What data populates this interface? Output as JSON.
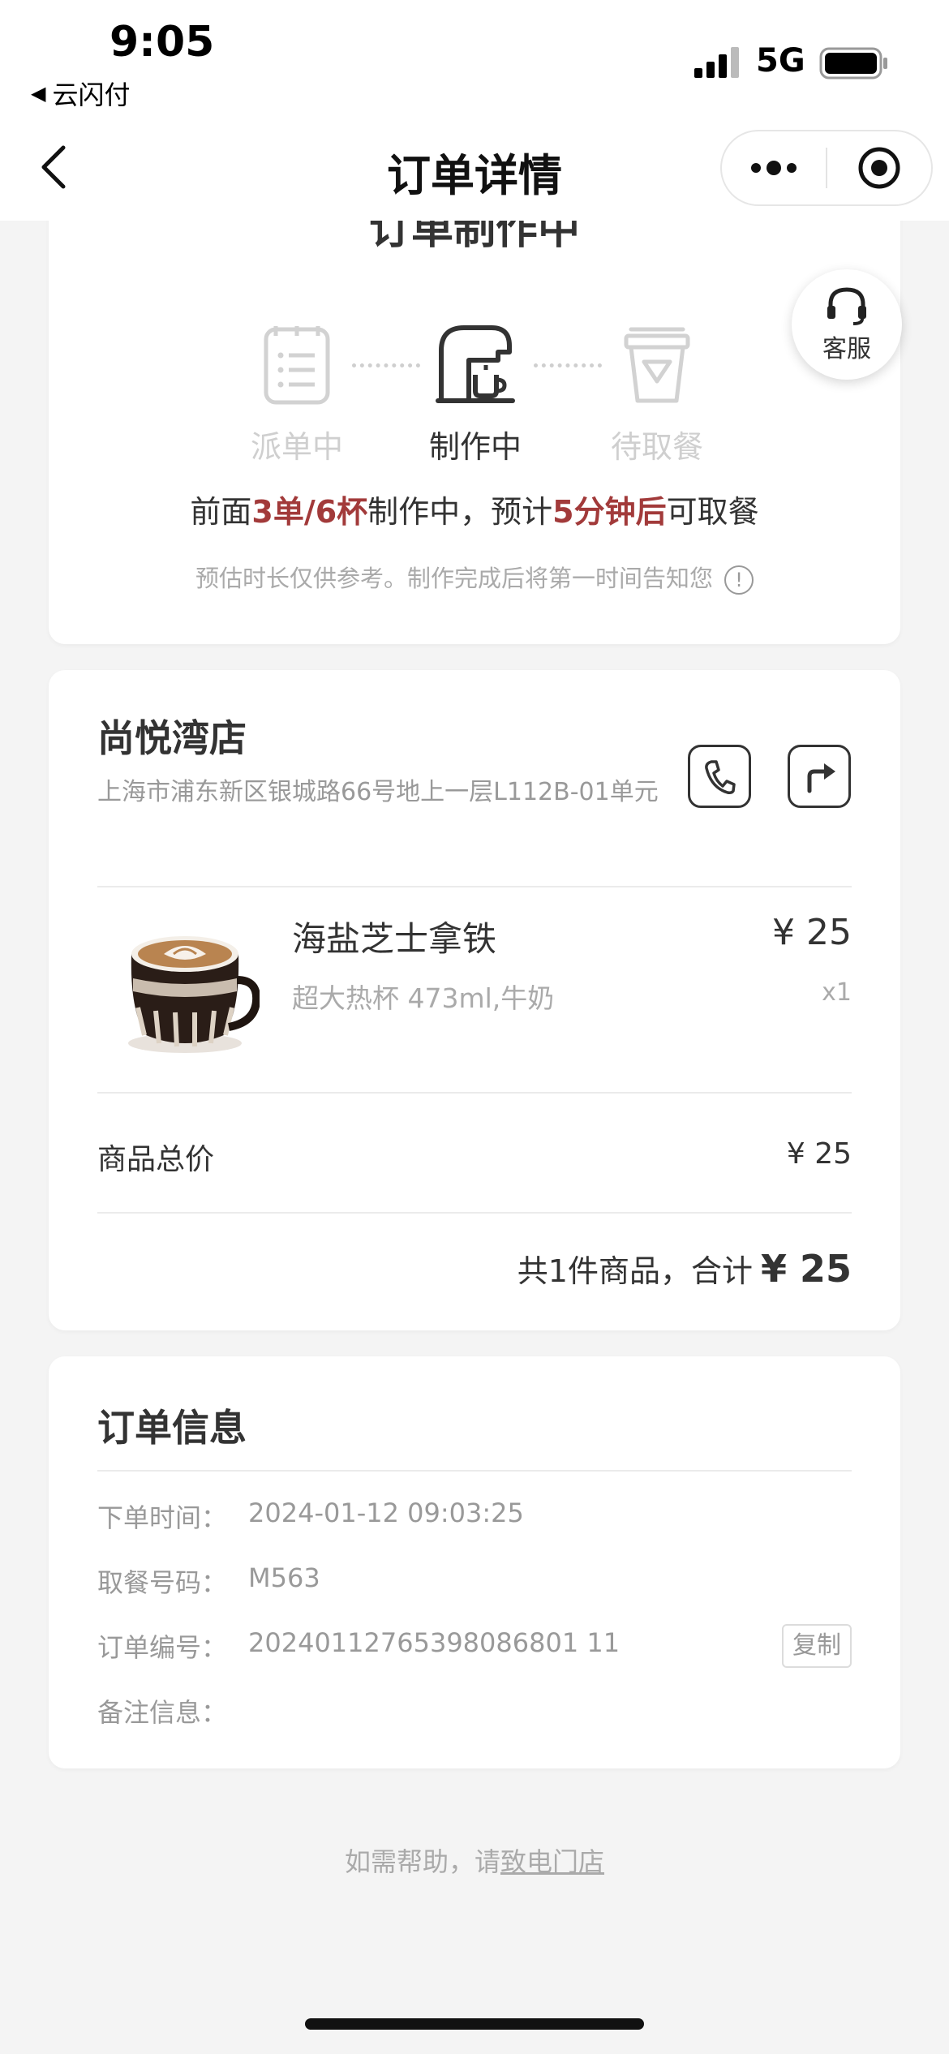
{
  "status_bar": {
    "time": "9:05",
    "back_app": "云闪付",
    "network": "5G"
  },
  "nav": {
    "title": "订单详情"
  },
  "order_status": {
    "heading": "订单制作中",
    "steps": [
      {
        "label": "派单中"
      },
      {
        "label": "制作中"
      },
      {
        "label": "待取餐"
      }
    ],
    "eta_prefix": "前面",
    "eta_queue": "3单/6杯",
    "eta_mid": "制作中，预计",
    "eta_time": "5分钟后",
    "eta_suffix": "可取餐",
    "note": "预估时长仅供参考。制作完成后将第一时间告知您",
    "info_glyph": "!"
  },
  "customer_service": {
    "label": "客服"
  },
  "store": {
    "name": "尚悦湾店",
    "address": "上海市浦东新区银城路66号地上一层L112B-01单元"
  },
  "product": {
    "name": "海盐芝士拿铁",
    "spec": "超大热杯 473ml,牛奶",
    "price": "¥ 25",
    "qty": "x1"
  },
  "totals": {
    "subtotal_label": "商品总价",
    "subtotal_value": "¥ 25",
    "summary_text": "共1件商品，合计",
    "summary_value": "¥ 25"
  },
  "order_info": {
    "title": "订单信息",
    "rows": [
      {
        "label": "下单时间：",
        "value": "2024-01-12 09:03:25"
      },
      {
        "label": "取餐号码：",
        "value": "M563"
      },
      {
        "label": "订单编号：",
        "value": "20240112765398086801 11"
      },
      {
        "label": "备注信息：",
        "value": ""
      }
    ],
    "copy_label": "复制"
  },
  "help": {
    "prefix": "如需帮助，请",
    "link": "致电门店"
  },
  "colors": {
    "accent": "#a23a3a",
    "muted": "#999999",
    "background": "#f4f4f4"
  }
}
